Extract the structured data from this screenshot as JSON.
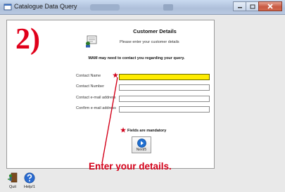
{
  "window": {
    "title": "Catalogue Data Query",
    "icon": "app-window-icon"
  },
  "overlay": {
    "step": "2)",
    "annotation": "Enter your details."
  },
  "form": {
    "heading": "Customer Details",
    "instruction": "Please enter your customer details",
    "notice": "MAM may need to contact you regarding your query.",
    "icon": "customer-form-icon",
    "fields": [
      {
        "label": "Contact Name",
        "value": "",
        "required": true
      },
      {
        "label": "Contact Number",
        "value": ""
      },
      {
        "label": "Contact e-mail address",
        "value": ""
      },
      {
        "label": "Confirm e-mail address",
        "value": ""
      }
    ],
    "mandatory_star": "★",
    "mandatory_note": "Fields are mandatory",
    "next_label": "Next/5"
  },
  "toolbar": {
    "buttons": [
      {
        "label": "Quit",
        "icon": "quit-icon"
      },
      {
        "label": "Help/1",
        "icon": "help-icon"
      }
    ]
  },
  "colors": {
    "annotation": "#d40019",
    "focused_field": "#ffec00",
    "mandatory": "#d0001a"
  }
}
